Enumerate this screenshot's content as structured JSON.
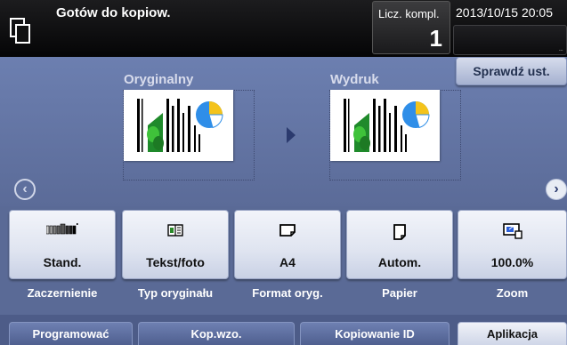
{
  "status_bar": {
    "message": "Gotów do kopiow.",
    "count_label": "Licz. kompl.",
    "count_value": "1",
    "datetime": "2013/10/15 20:05",
    "dots": "..."
  },
  "preview": {
    "original_label": "Oryginalny",
    "output_label": "Wydruk",
    "check_settings_label": "Sprawdź ust."
  },
  "tiles": [
    {
      "id": "density",
      "value": "Stand.",
      "caption": "Zaczernienie",
      "icon": "density-scale-icon"
    },
    {
      "id": "original-type",
      "value": "Tekst/foto",
      "caption": "Typ oryginału",
      "icon": "book-photo-icon"
    },
    {
      "id": "original-size",
      "value": "A4",
      "caption": "Format oryg.",
      "icon": "landscape-page-icon"
    },
    {
      "id": "paper",
      "value": "Autom.",
      "caption": "Papier",
      "icon": "portrait-page-icon"
    },
    {
      "id": "zoom",
      "value": "100.0%",
      "caption": "Zoom",
      "icon": "zoom-icon"
    }
  ],
  "tabs": [
    {
      "label": "Programować",
      "active": false
    },
    {
      "label": "Kop.wzo.",
      "active": false
    },
    {
      "label": "Kopiowanie ID",
      "active": false
    },
    {
      "label": "Aplikacja",
      "active": true
    }
  ],
  "colors": {
    "background": "#5a6a96",
    "topbar": "#050506",
    "tile": "#e6eaf4",
    "accent": "#2b3a6e"
  }
}
